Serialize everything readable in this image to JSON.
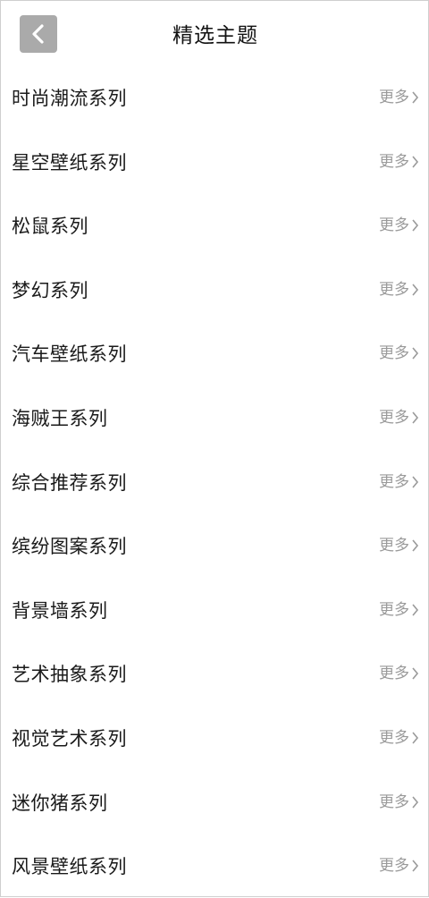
{
  "header": {
    "title": "精选主题",
    "back_icon": "chevron-left-icon"
  },
  "list": {
    "more_label": "更多",
    "more_icon": "chevron-right-icon",
    "items": [
      {
        "label": "时尚潮流系列"
      },
      {
        "label": "星空壁纸系列"
      },
      {
        "label": "松鼠系列"
      },
      {
        "label": "梦幻系列"
      },
      {
        "label": "汽车壁纸系列"
      },
      {
        "label": "海贼王系列"
      },
      {
        "label": "综合推荐系列"
      },
      {
        "label": "缤纷图案系列"
      },
      {
        "label": "背景墙系列"
      },
      {
        "label": "艺术抽象系列"
      },
      {
        "label": "视觉艺术系列"
      },
      {
        "label": "迷你猪系列"
      },
      {
        "label": "风景壁纸系列"
      }
    ]
  },
  "colors": {
    "back_button_bg": "#aaaaaa",
    "more_text": "#9a9a9a"
  }
}
